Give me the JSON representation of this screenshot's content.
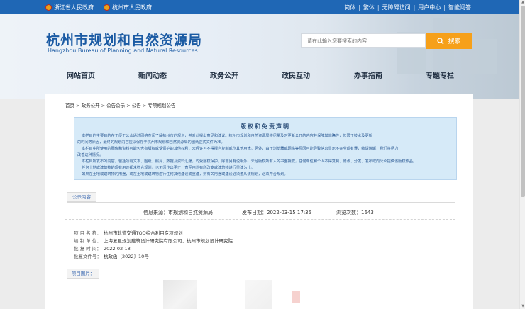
{
  "topbar": {
    "gov_links": [
      "浙江省人民政府",
      "杭州市人民政府"
    ],
    "links": [
      "简体",
      "繁体",
      "无障碍访问",
      "用户中心",
      "智能问答"
    ],
    "separator": "|"
  },
  "header": {
    "logo_cn": "杭州市规划和自然资源局",
    "logo_en": "Hangzhou Bureau of Planning and Natural Resources",
    "search_placeholder": "请在此输入您要搜索的内容",
    "search_button": "搜索"
  },
  "nav": {
    "items": [
      "网站首页",
      "新闻动态",
      "政务公开",
      "政民互动",
      "办事指南",
      "专题专栏"
    ]
  },
  "breadcrumb": "首页 > 政务公开 > 公告公示 > 公告 > 专项规划公告",
  "notice": {
    "title": "版权和免责声明",
    "lines": [
      "本栏目的主要目的在于便于公众通过网络查阅了解杭州市的规划，并对此提出意见和建议。杭州市规划和自然资源局将尽量及时更新公开的内容并保障其准确性，但限于技术及更新",
      "的时间等原因，最终的规划内容应以保存于杭州市规划和自然资源局的图纸正式文件为准。",
      "本栏目中所使用的图像和资料可能包含有版权或受保护的其他权利，未经许可不得擅自复制或作其他用途。另外，由于浏览器或网络等原因可能导致信息显示不完全或有误，敬请谅解，我们将尽力",
      "改善这种情况。",
      "本栏目所发布的内容，包括所有文本、图纸、照片、数据及资料汇编，均受版权保护。除非另有说明外，未经版权所有人的书面授权，任何单位和个人不得复制、修改、分发、发布或向公众提供该版权作品。",
      "任何土地或建筑物的现有用途都未符合规划，也无须作出更正，直至用途有所改变或建筑物进行重建为止。",
      "如果在土地或建筑物的用途，或在土地或建筑物进行任何其他建设或重建，则有关用途或建设必须遵从该规划，必须符合规划。"
    ]
  },
  "section1": "公示内容",
  "meta": {
    "source": "信息来源：市规划和自然资源局",
    "date": "发布日期：2022-03-15 17:35",
    "views": "浏览次数：1643"
  },
  "info": {
    "project_label": "项 目 名 称：",
    "project": "杭州市轨道交通TOD综合利用专项规划",
    "unit_label": "编 制 单 位：",
    "unit": "上海复旦规划建筑设计研究院有限公司、杭州市规划设计研究院",
    "approve_date_label": "批 复 时 间：",
    "approve_date": "2022-02-18",
    "doc_no_label": "批复文件号：",
    "doc_no": "杭政函〔2022〕10号"
  },
  "section2": "项目图片："
}
